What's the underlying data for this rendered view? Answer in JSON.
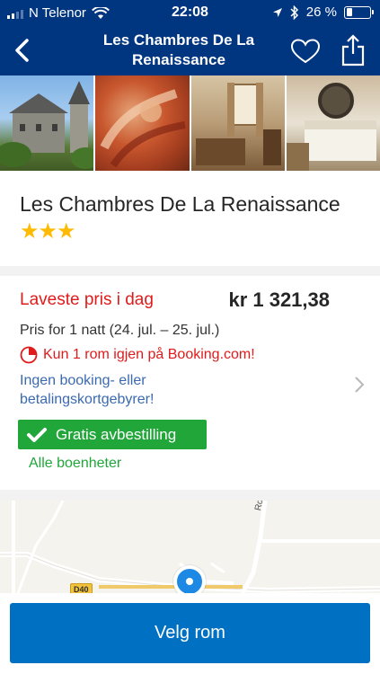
{
  "status_bar": {
    "carrier": "N Telenor",
    "time": "22:08",
    "battery_percent": "26 %",
    "battery_level": 0.26,
    "signal_bars": 2
  },
  "nav": {
    "title": "Les Chambres De La Renaissance",
    "back_icon": "chevron-left-icon",
    "favorite_icon": "heart-outline-icon",
    "share_icon": "share-icon"
  },
  "hotel": {
    "name": "Les Chambres De La Renaissance",
    "stars": "★★★",
    "star_rating": 3
  },
  "pricing": {
    "lowest_price_label": "Laveste pris i dag",
    "price": "kr 1 321,38",
    "price_for": "Pris for 1 natt (24. jul. – 25. jul.)",
    "rooms_left": "Kun 1 rom igjen på Booking.com!",
    "no_fees": "Ingen booking- eller betalingskortgebyrer!",
    "free_cancellation": "Gratis avbestilling",
    "all_units": "Alle boenheter"
  },
  "map": {
    "road_label": "Route",
    "road_badge": "D40"
  },
  "cta": {
    "label": "Velg rom"
  },
  "colors": {
    "brand_blue": "#003580",
    "button_blue": "#0071c2",
    "alert_red": "#e01b1b",
    "success_green": "#21a63a",
    "link_blue": "#3a6ab0",
    "star_yellow": "#febb02"
  }
}
